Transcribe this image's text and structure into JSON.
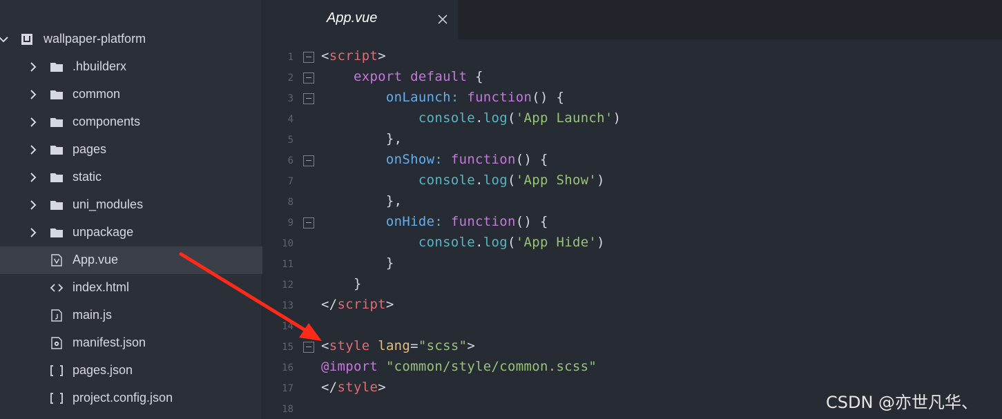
{
  "sidebar": {
    "items": [
      {
        "label": "wallpaper-platform",
        "icon": "project-icon",
        "chevron": "down",
        "level": 0
      },
      {
        "label": ".hbuilderx",
        "icon": "folder-icon",
        "chevron": "right",
        "level": 1
      },
      {
        "label": "common",
        "icon": "folder-icon",
        "chevron": "right",
        "level": 1
      },
      {
        "label": "components",
        "icon": "folder-icon",
        "chevron": "right",
        "level": 1
      },
      {
        "label": "pages",
        "icon": "folder-icon",
        "chevron": "right",
        "level": 1
      },
      {
        "label": "static",
        "icon": "folder-icon",
        "chevron": "right",
        "level": 1
      },
      {
        "label": "uni_modules",
        "icon": "folder-icon",
        "chevron": "right",
        "level": 1
      },
      {
        "label": "unpackage",
        "icon": "folder-icon",
        "chevron": "right",
        "level": 1
      },
      {
        "label": "App.vue",
        "icon": "vue-file-icon",
        "chevron": "",
        "level": 1,
        "selected": true
      },
      {
        "label": "index.html",
        "icon": "html-file-icon",
        "chevron": "",
        "level": 1
      },
      {
        "label": "main.js",
        "icon": "js-file-icon",
        "chevron": "",
        "level": 1
      },
      {
        "label": "manifest.json",
        "icon": "settings-file-icon",
        "chevron": "",
        "level": 1
      },
      {
        "label": "pages.json",
        "icon": "json-file-icon",
        "chevron": "",
        "level": 1
      },
      {
        "label": "project.config.json",
        "icon": "json-file-icon",
        "chevron": "",
        "level": 1
      }
    ]
  },
  "tab": {
    "title": "App.vue",
    "close": "×"
  },
  "editor": {
    "lines": [
      {
        "n": "1",
        "fold": true,
        "tokens": [
          [
            "<",
            "t-punct"
          ],
          [
            "script",
            "t-tag"
          ],
          [
            ">",
            "t-punct"
          ]
        ]
      },
      {
        "n": "2",
        "fold": true,
        "tokens": [
          [
            "    ",
            ""
          ],
          [
            "export",
            "t-kw"
          ],
          [
            " ",
            ""
          ],
          [
            "default",
            "t-kw"
          ],
          [
            " {",
            "t-punct"
          ]
        ]
      },
      {
        "n": "3",
        "fold": true,
        "tokens": [
          [
            "        ",
            ""
          ],
          [
            "onLaunch",
            "t-fn"
          ],
          [
            ": ",
            "t-cyan"
          ],
          [
            "function",
            "t-kw"
          ],
          [
            "() {",
            "t-punct"
          ]
        ]
      },
      {
        "n": "4",
        "fold": false,
        "tokens": [
          [
            "            ",
            ""
          ],
          [
            "console",
            "t-cyan"
          ],
          [
            ".",
            "t-punct"
          ],
          [
            "log",
            "t-cyan"
          ],
          [
            "(",
            "t-punct"
          ],
          [
            "'App Launch'",
            "t-str"
          ],
          [
            ")",
            "t-punct"
          ]
        ]
      },
      {
        "n": "5",
        "fold": false,
        "tokens": [
          [
            "        },",
            "t-punct"
          ]
        ]
      },
      {
        "n": "6",
        "fold": true,
        "tokens": [
          [
            "        ",
            ""
          ],
          [
            "onShow",
            "t-fn"
          ],
          [
            ": ",
            "t-cyan"
          ],
          [
            "function",
            "t-kw"
          ],
          [
            "() {",
            "t-punct"
          ]
        ]
      },
      {
        "n": "7",
        "fold": false,
        "tokens": [
          [
            "            ",
            ""
          ],
          [
            "console",
            "t-cyan"
          ],
          [
            ".",
            "t-punct"
          ],
          [
            "log",
            "t-cyan"
          ],
          [
            "(",
            "t-punct"
          ],
          [
            "'App Show'",
            "t-str"
          ],
          [
            ")",
            "t-punct"
          ]
        ]
      },
      {
        "n": "8",
        "fold": false,
        "tokens": [
          [
            "        },",
            "t-punct"
          ]
        ]
      },
      {
        "n": "9",
        "fold": true,
        "tokens": [
          [
            "        ",
            ""
          ],
          [
            "onHide",
            "t-fn"
          ],
          [
            ": ",
            "t-cyan"
          ],
          [
            "function",
            "t-kw"
          ],
          [
            "() {",
            "t-punct"
          ]
        ]
      },
      {
        "n": "10",
        "fold": false,
        "tokens": [
          [
            "            ",
            ""
          ],
          [
            "console",
            "t-cyan"
          ],
          [
            ".",
            "t-punct"
          ],
          [
            "log",
            "t-cyan"
          ],
          [
            "(",
            "t-punct"
          ],
          [
            "'App Hide'",
            "t-str"
          ],
          [
            ")",
            "t-punct"
          ]
        ]
      },
      {
        "n": "11",
        "fold": false,
        "tokens": [
          [
            "        }",
            "t-punct"
          ]
        ]
      },
      {
        "n": "12",
        "fold": false,
        "tokens": [
          [
            "    }",
            "t-punct"
          ]
        ]
      },
      {
        "n": "13",
        "fold": false,
        "tokens": [
          [
            "</",
            "t-punct"
          ],
          [
            "script",
            "t-tag"
          ],
          [
            ">",
            "t-punct"
          ]
        ]
      },
      {
        "n": "14",
        "fold": false,
        "tokens": []
      },
      {
        "n": "15",
        "fold": true,
        "tokens": [
          [
            "<",
            "t-punct"
          ],
          [
            "style",
            "t-tag"
          ],
          [
            " ",
            ""
          ],
          [
            "lang",
            "t-attr"
          ],
          [
            "=",
            "t-punct"
          ],
          [
            "\"scss\"",
            "t-str"
          ],
          [
            ">",
            "t-punct"
          ]
        ]
      },
      {
        "n": "16",
        "fold": false,
        "tokens": [
          [
            "@import",
            "t-kw"
          ],
          [
            " ",
            ""
          ],
          [
            "\"common/style/common.scss\"",
            "t-str"
          ]
        ]
      },
      {
        "n": "17",
        "fold": false,
        "tokens": [
          [
            "</",
            "t-punct"
          ],
          [
            "style",
            "t-tag"
          ],
          [
            ">",
            "t-punct"
          ]
        ]
      },
      {
        "n": "18",
        "fold": false,
        "tokens": []
      }
    ]
  },
  "watermark": "CSDN @亦世凡华、",
  "colors": {
    "arrow": "#ff2a1a",
    "background": "#272b33",
    "sidebar": "#2b2f37"
  }
}
